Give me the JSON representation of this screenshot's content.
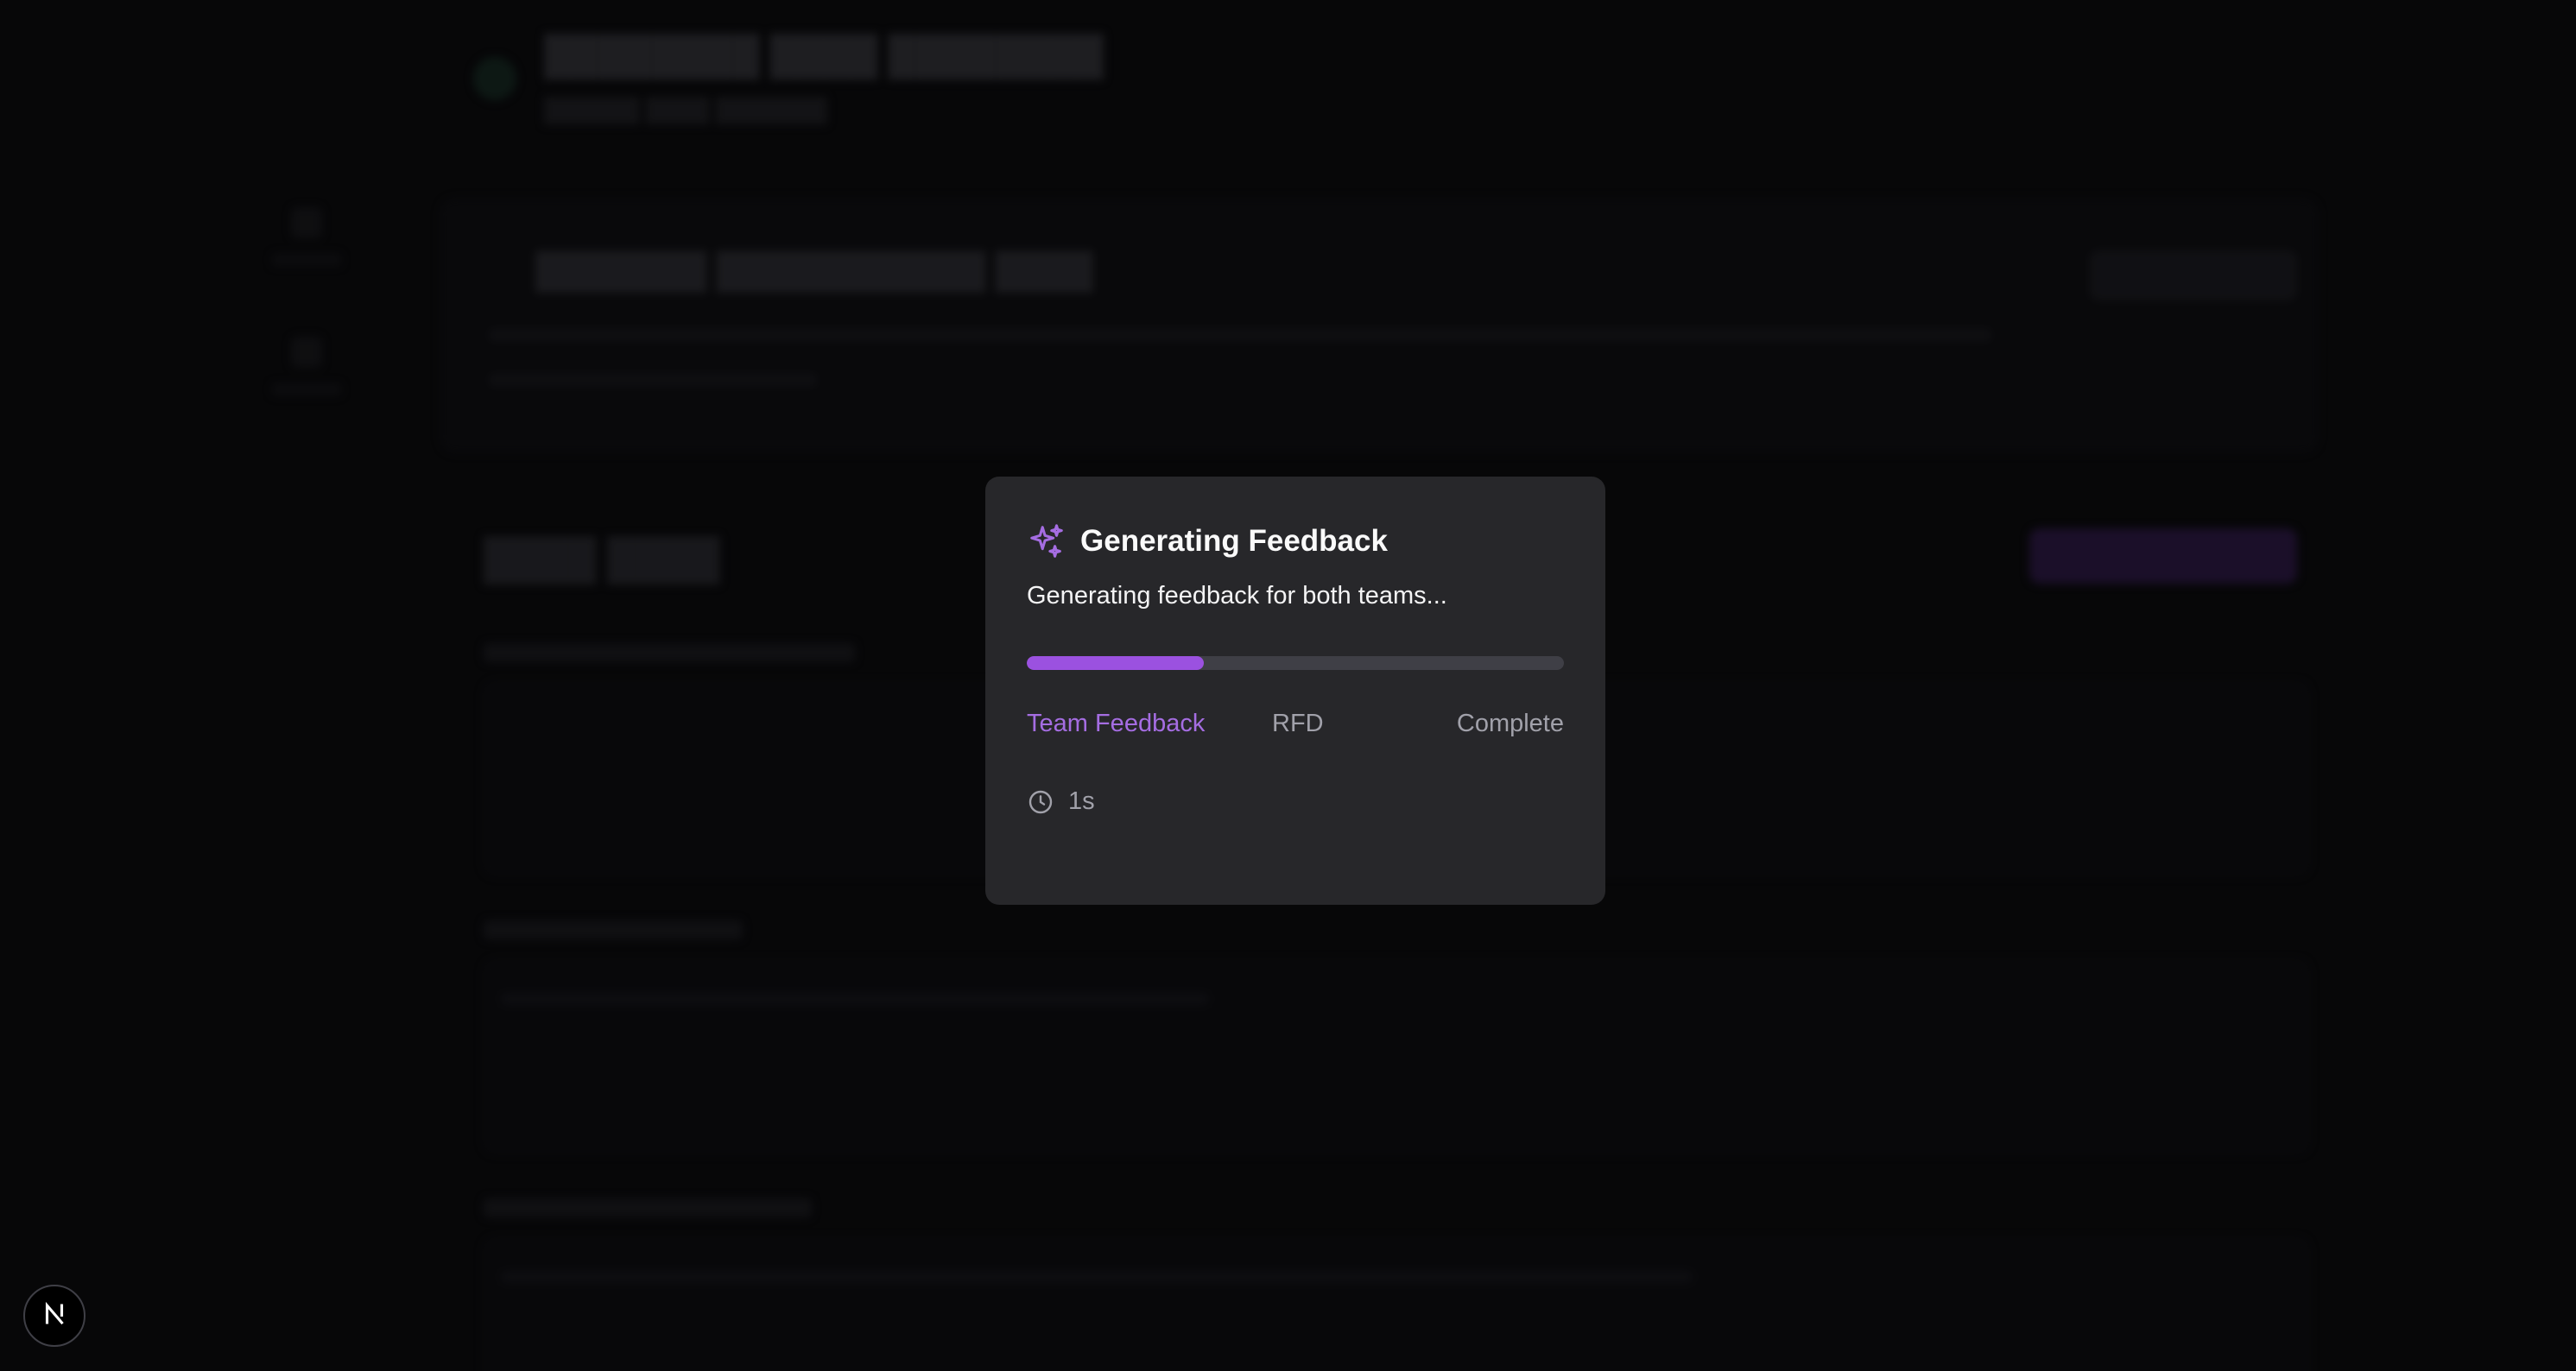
{
  "colors": {
    "accent": "#9b51e0",
    "accent_text": "#a56de2",
    "modal_bg": "#27272a",
    "page_bg": "#0b0b0d",
    "progress_track": "#3f3f46"
  },
  "modal": {
    "icon": "sparkles-icon",
    "title": "Generating Feedback",
    "description": "Generating feedback for both teams...",
    "progress_fraction": 0.33,
    "steps": [
      {
        "label": "Team Feedback",
        "state": "active"
      },
      {
        "label": "RFD",
        "state": "pending"
      },
      {
        "label": "Complete",
        "state": "pending"
      }
    ],
    "timer_icon": "clock-icon",
    "elapsed": "1s"
  },
  "dev_badge": {
    "icon": "next-logo-icon",
    "label": "N"
  }
}
